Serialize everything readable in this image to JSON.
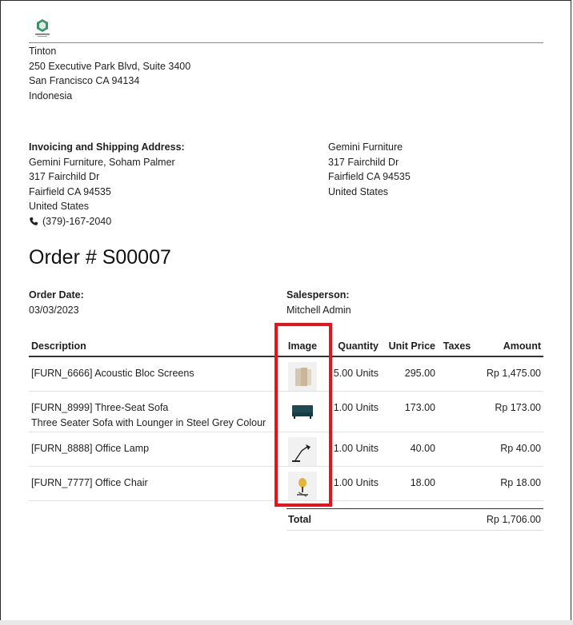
{
  "company": {
    "name": "Tinton",
    "address_line1": "250 Executive Park Blvd, Suite 3400",
    "address_line2": "San Francisco CA 94134",
    "country": "Indonesia"
  },
  "invoicing": {
    "heading": "Invoicing and Shipping Address:",
    "name": "Gemini Furniture, Soham Palmer",
    "street": "317 Fairchild Dr",
    "city": "Fairfield CA 94535",
    "country": "United States",
    "phone": "(379)-167-2040"
  },
  "shipping": {
    "name": "Gemini Furniture",
    "street": "317 Fairchild Dr",
    "city": "Fairfield CA 94535",
    "country": "United States"
  },
  "order": {
    "title": "Order # S00007",
    "date_label": "Order Date:",
    "date_value": "03/03/2023",
    "salesperson_label": "Salesperson:",
    "salesperson_value": "Mitchell Admin"
  },
  "table": {
    "headers": [
      "Description",
      "Image",
      "Quantity",
      "Unit Price",
      "Taxes",
      "Amount"
    ],
    "rows": [
      {
        "description": "[FURN_6666] Acoustic Bloc Screens",
        "note": "",
        "image_icon": "acoustic-screen-icon",
        "quantity": "5.00 Units",
        "unit_price": "295.00",
        "taxes": "",
        "amount": "Rp 1,475.00"
      },
      {
        "description": "[FURN_8999] Three-Seat Sofa",
        "note": "Three Seater Sofa with Lounger in Steel Grey Colour",
        "image_icon": "sofa-icon",
        "quantity": "1.00 Units",
        "unit_price": "173.00",
        "taxes": "",
        "amount": "Rp 173.00"
      },
      {
        "description": "[FURN_8888] Office Lamp",
        "note": "",
        "image_icon": "lamp-icon",
        "quantity": "1.00 Units",
        "unit_price": "40.00",
        "taxes": "",
        "amount": "Rp 40.00"
      },
      {
        "description": "[FURN_7777] Office Chair",
        "note": "",
        "image_icon": "chair-icon",
        "quantity": "1.00 Units",
        "unit_price": "18.00",
        "taxes": "",
        "amount": "Rp 18.00"
      }
    ]
  },
  "totals": {
    "label": "Total",
    "value": "Rp 1,706.00"
  },
  "colors": {
    "highlight": "#e8131a",
    "sofa": "#1d4a52",
    "chair": "#e3b53c"
  }
}
